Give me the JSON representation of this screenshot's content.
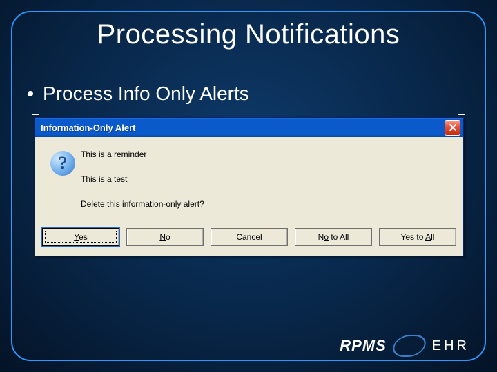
{
  "slide": {
    "title": "Processing Notifications",
    "bullet": "Process Info Only Alerts"
  },
  "dialog": {
    "title": "Information-Only Alert",
    "messages": {
      "line1": "This is a reminder",
      "line2": "This is a test",
      "line3": "Delete this information-only alert?"
    },
    "buttons": {
      "yes": "Yes",
      "no": "No",
      "cancel": "Cancel",
      "no_all": "No to All",
      "yes_all": "Yes to All"
    }
  },
  "logo": {
    "brand": "RPMS",
    "suffix": "EHR"
  }
}
